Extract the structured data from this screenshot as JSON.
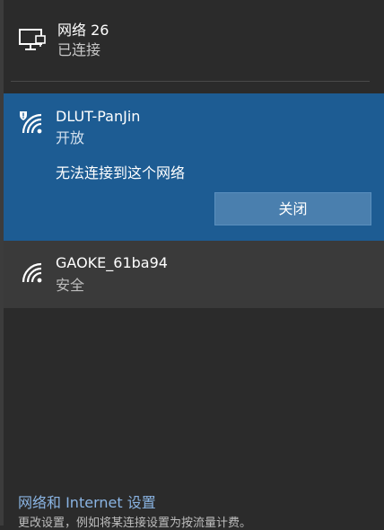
{
  "ethernet": {
    "name": "网络 26",
    "status": "已连接",
    "icon": "ethernet-monitor-icon"
  },
  "selected_network": {
    "name": "DLUT-PanJin",
    "security": "开放",
    "message": "无法连接到这个网络",
    "close_label": "关闭",
    "icon": "wifi-warning-icon",
    "bg_color": "#1d5c93"
  },
  "networks": [
    {
      "name": "GAOKE_61ba94",
      "security": "安全",
      "icon": "wifi-icon"
    }
  ],
  "footer": {
    "settings_link": "网络和 Internet 设置",
    "settings_desc": "更改设置，例如将某连接设置为按流量计费。"
  }
}
